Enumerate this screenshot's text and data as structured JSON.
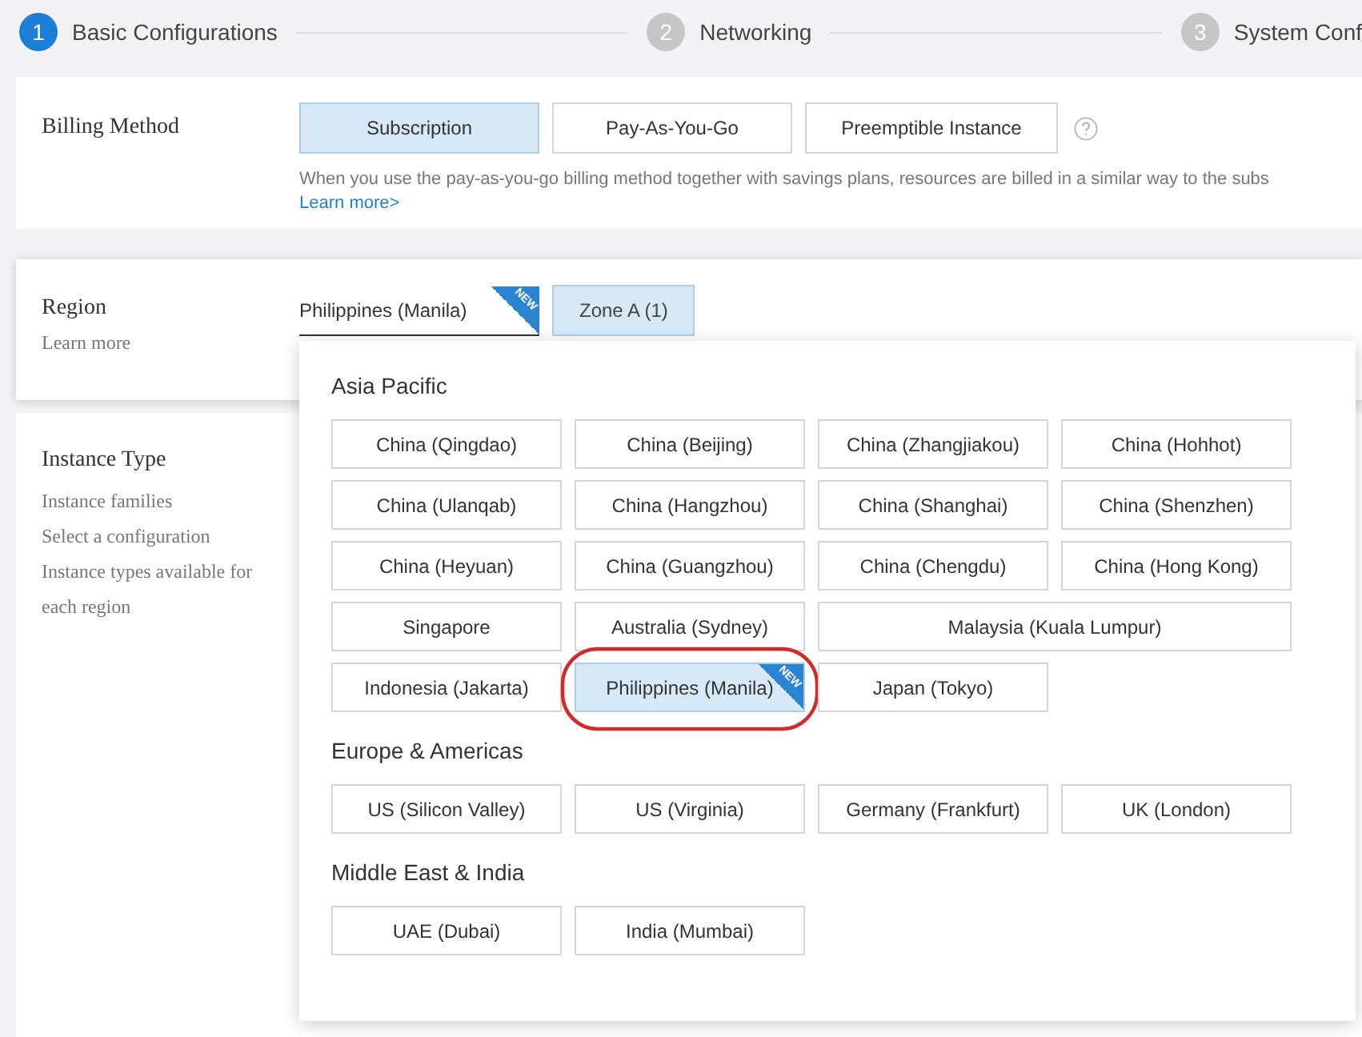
{
  "steps": [
    {
      "number": "1",
      "label": "Basic Configurations",
      "active": true
    },
    {
      "number": "2",
      "label": "Networking",
      "active": false
    },
    {
      "number": "3",
      "label": "System Conf",
      "active": false
    }
  ],
  "billing": {
    "label": "Billing Method",
    "options": [
      {
        "label": "Subscription",
        "selected": true
      },
      {
        "label": "Pay-As-You-Go",
        "selected": false
      },
      {
        "label": "Preemptible Instance",
        "selected": false
      }
    ],
    "note": "When you use the pay-as-you-go billing method together with savings plans, resources are billed in a similar way to the subs",
    "link": "Learn more>"
  },
  "region": {
    "label": "Region",
    "learn_more": "Learn more",
    "value": "Philippines (Manila)",
    "badge": "NEW",
    "zone": "Zone A (1)"
  },
  "instance_type": {
    "label": "Instance Type",
    "lines": [
      "Instance families",
      "Select a configuration",
      "Instance types available for each region"
    ]
  },
  "dropdown": {
    "groups": [
      {
        "title": "Asia Pacific",
        "regions": [
          {
            "name": "China (Qingdao)",
            "selected": false,
            "wide": false,
            "circled": false
          },
          {
            "name": "China (Beijing)",
            "selected": false,
            "wide": false,
            "circled": false
          },
          {
            "name": "China (Zhangjiakou)",
            "selected": false,
            "wide": false,
            "circled": false
          },
          {
            "name": "China (Hohhot)",
            "selected": false,
            "wide": false,
            "circled": false
          },
          {
            "name": "China (Ulanqab)",
            "selected": false,
            "wide": false,
            "circled": false
          },
          {
            "name": "China (Hangzhou)",
            "selected": false,
            "wide": false,
            "circled": false
          },
          {
            "name": "China (Shanghai)",
            "selected": false,
            "wide": false,
            "circled": false
          },
          {
            "name": "China (Shenzhen)",
            "selected": false,
            "wide": false,
            "circled": false
          },
          {
            "name": "China (Heyuan)",
            "selected": false,
            "wide": false,
            "circled": false
          },
          {
            "name": "China (Guangzhou)",
            "selected": false,
            "wide": false,
            "circled": false
          },
          {
            "name": "China (Chengdu)",
            "selected": false,
            "wide": false,
            "circled": false
          },
          {
            "name": "China (Hong Kong)",
            "selected": false,
            "wide": false,
            "circled": false
          },
          {
            "name": "Singapore",
            "selected": false,
            "wide": false,
            "circled": false
          },
          {
            "name": "Australia (Sydney)",
            "selected": false,
            "wide": false,
            "circled": false
          },
          {
            "name": "Malaysia (Kuala Lumpur)",
            "selected": false,
            "wide": true,
            "circled": false
          },
          {
            "name": "Indonesia (Jakarta)",
            "selected": false,
            "wide": false,
            "circled": false
          },
          {
            "name": "Philippines (Manila)",
            "selected": true,
            "wide": false,
            "circled": true,
            "badge": "NEW"
          },
          {
            "name": "Japan (Tokyo)",
            "selected": false,
            "wide": false,
            "circled": false
          }
        ]
      },
      {
        "title": "Europe & Americas",
        "regions": [
          {
            "name": "US (Silicon Valley)",
            "selected": false,
            "wide": false,
            "circled": false
          },
          {
            "name": "US (Virginia)",
            "selected": false,
            "wide": false,
            "circled": false
          },
          {
            "name": "Germany (Frankfurt)",
            "selected": false,
            "wide": false,
            "circled": false
          },
          {
            "name": "UK (London)",
            "selected": false,
            "wide": false,
            "circled": false
          }
        ]
      },
      {
        "title": "Middle East & India",
        "regions": [
          {
            "name": "UAE (Dubai)",
            "selected": false,
            "wide": false,
            "circled": false
          },
          {
            "name": "India (Mumbai)",
            "selected": false,
            "wide": false,
            "circled": false
          }
        ]
      }
    ]
  }
}
